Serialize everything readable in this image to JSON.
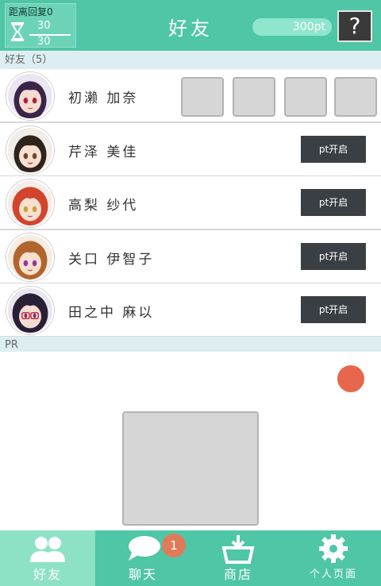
{
  "header": {
    "recovery_label": "距离回复0",
    "stamina_current": "30",
    "stamina_max": "30",
    "title": "好友",
    "points": "300pt",
    "help_label": "?"
  },
  "friends_section": {
    "label": "好友（5）"
  },
  "friends": [
    {
      "name": "初濑 加奈",
      "hair": "#3a2548",
      "skin": "#f6dbcf"
    },
    {
      "name": "芹泽 美佳",
      "hair": "#2d241e",
      "skin": "#f7e0cf",
      "button": "pt开启"
    },
    {
      "name": "高梨 纱代",
      "hair": "#d2442c",
      "skin": "#f8e0cf",
      "button": "pt开启"
    },
    {
      "name": "关口 伊智子",
      "hair": "#b0642e",
      "skin": "#f7dfcd",
      "button": "pt开启"
    },
    {
      "name": "田之中 麻以",
      "hair": "#2a2036",
      "skin": "#f3dcd2",
      "button": "pt开启"
    }
  ],
  "pr_section": {
    "label": "PR"
  },
  "nav": {
    "items": [
      {
        "label": "好友",
        "icon": "friends-icon",
        "active": true
      },
      {
        "label": "聊天",
        "icon": "chat-icon",
        "badge": "1"
      },
      {
        "label": "商店",
        "icon": "shop-icon"
      },
      {
        "label": "个人页面",
        "icon": "gear-icon"
      }
    ]
  },
  "colors": {
    "accent": "#4fc6a6",
    "accent_light": "#8de2c6",
    "dark_button": "#3a3f44",
    "badge": "#e07b59"
  }
}
